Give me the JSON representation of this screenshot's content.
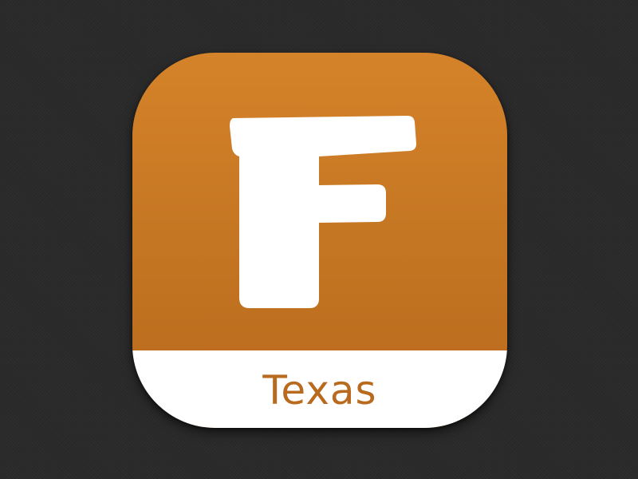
{
  "icon": {
    "letter": "F",
    "label": "Texas",
    "background_color": "#c57622",
    "label_color": "#b86a1e",
    "letter_color": "#ffffff",
    "label_bar_color": "#ffffff"
  },
  "page": {
    "background_color": "#2a2a2b"
  }
}
